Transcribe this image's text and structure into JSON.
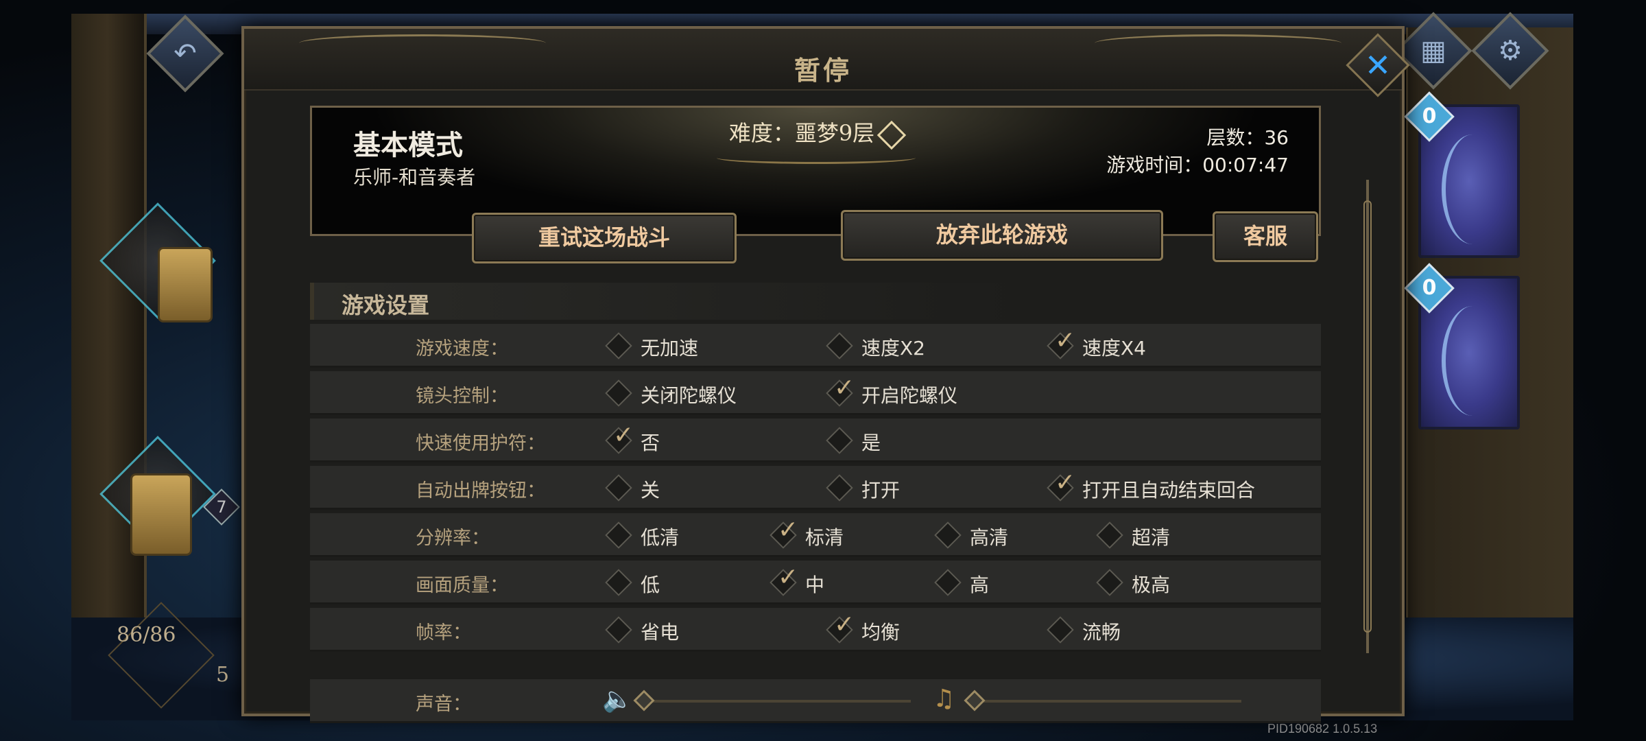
{
  "background": {
    "hp_text": "86/86",
    "energy_text": "5",
    "deck_badge": "7",
    "side_cards": [
      {
        "cost": "0"
      },
      {
        "cost": "0"
      }
    ],
    "hud": {
      "back_icon": "undo-arrow-icon",
      "map_icon": "map-icon",
      "settings_icon": "gear-icon"
    }
  },
  "dialog": {
    "title": "暂停",
    "close_icon": "close-x-icon",
    "info": {
      "mode": "基本模式",
      "character": "乐师-和音奏者",
      "difficulty": "难度：噩梦9层",
      "floor": "层数：36",
      "game_time": "游戏时间：00:07:47"
    },
    "actions": {
      "retry": "重试这场战斗",
      "abandon": "放弃此轮游戏",
      "support": "客服"
    },
    "settings_title": "游戏设置",
    "settings": [
      {
        "label": "游戏速度：",
        "options": [
          {
            "text": "无加速",
            "checked": false
          },
          {
            "text": "速度X2",
            "checked": false
          },
          {
            "text": "速度X4",
            "checked": true
          }
        ]
      },
      {
        "label": "镜头控制：",
        "options": [
          {
            "text": "关闭陀螺仪",
            "checked": false
          },
          {
            "text": "开启陀螺仪",
            "checked": true
          }
        ]
      },
      {
        "label": "快速使用护符：",
        "options": [
          {
            "text": "否",
            "checked": true
          },
          {
            "text": "是",
            "checked": false
          }
        ]
      },
      {
        "label": "自动出牌按钮：",
        "options": [
          {
            "text": "关",
            "checked": false
          },
          {
            "text": "打开",
            "checked": false
          },
          {
            "text": "打开且自动结束回合",
            "checked": true
          }
        ]
      },
      {
        "label": "分辨率：",
        "options": [
          {
            "text": "低清",
            "checked": false
          },
          {
            "text": "标清",
            "checked": true
          },
          {
            "text": "高清",
            "checked": false
          },
          {
            "text": "超清",
            "checked": false
          }
        ]
      },
      {
        "label": "画面质量：",
        "options": [
          {
            "text": "低",
            "checked": false
          },
          {
            "text": "中",
            "checked": true
          },
          {
            "text": "高",
            "checked": false
          },
          {
            "text": "极高",
            "checked": false
          }
        ]
      },
      {
        "label": "帧率：",
        "options": [
          {
            "text": "省电",
            "checked": false
          },
          {
            "text": "均衡",
            "checked": true
          },
          {
            "text": "流畅",
            "checked": false
          }
        ]
      }
    ],
    "sound": {
      "label": "声音：",
      "sfx_icon": "speaker-icon",
      "music_icon": "music-note-icon",
      "sfx_level": 0.0,
      "music_level": 0.0
    }
  },
  "version": "PID190682  1.0.5.13"
}
